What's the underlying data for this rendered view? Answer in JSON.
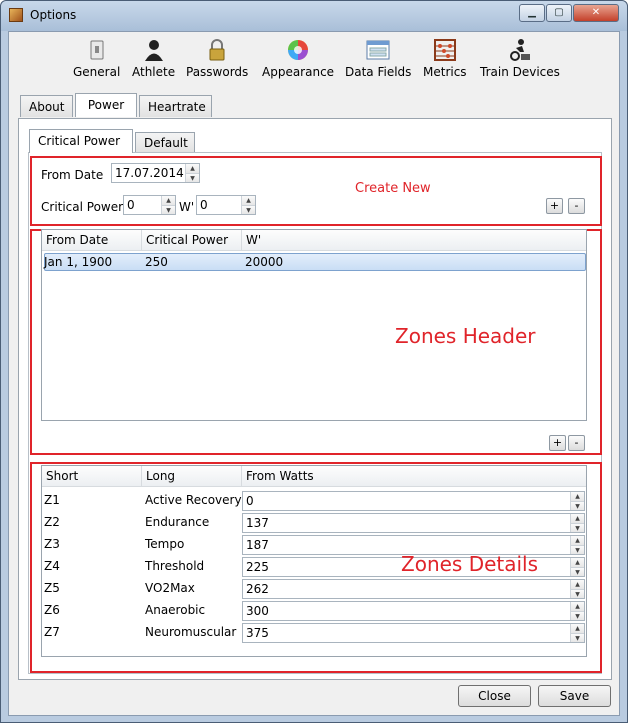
{
  "window": {
    "title": "Options",
    "minimize_label": "▁",
    "maximize_label": "▢",
    "close_label": "✕"
  },
  "toolbar": [
    {
      "label": "General",
      "icon": "switch-icon"
    },
    {
      "label": "Athlete",
      "icon": "person-icon"
    },
    {
      "label": "Passwords",
      "icon": "padlock-icon"
    },
    {
      "label": "Appearance",
      "icon": "color-wheel-icon"
    },
    {
      "label": "Data Fields",
      "icon": "form-icon"
    },
    {
      "label": "Metrics",
      "icon": "abacus-icon"
    },
    {
      "label": "Train Devices",
      "icon": "cyclist-icon"
    }
  ],
  "tabs": [
    {
      "label": "About"
    },
    {
      "label": "Power",
      "active": true
    },
    {
      "label": "Heartrate"
    }
  ],
  "subtabs": [
    {
      "label": "Critical Power",
      "active": true
    },
    {
      "label": "Default"
    }
  ],
  "create": {
    "from_date_label": "From Date",
    "from_date_value": "17.07.2014",
    "cp_label": "Critical Power",
    "cp_value": "0",
    "wprime_label": "W'",
    "wprime_value": "0",
    "add_label": "+",
    "remove_label": "-"
  },
  "annotations": {
    "create_new": "Create New",
    "zones_header": "Zones Header",
    "zones_details": "Zones Details",
    "color": "#e0242a"
  },
  "zones_header": {
    "columns": [
      "From Date",
      "Critical Power",
      "W'"
    ],
    "rows": [
      {
        "date": "Jan 1, 1900",
        "cp": "250",
        "wprime": "20000"
      }
    ],
    "add_label": "+",
    "remove_label": "-"
  },
  "zones": {
    "columns": [
      "Short",
      "Long",
      "From Watts"
    ],
    "rows": [
      {
        "short": "Z1",
        "long": "Active Recovery",
        "watts": "0"
      },
      {
        "short": "Z2",
        "long": "Endurance",
        "watts": "137"
      },
      {
        "short": "Z3",
        "long": "Tempo",
        "watts": "187"
      },
      {
        "short": "Z4",
        "long": "Threshold",
        "watts": "225"
      },
      {
        "short": "Z5",
        "long": "VO2Max",
        "watts": "262"
      },
      {
        "short": "Z6",
        "long": "Anaerobic",
        "watts": "300"
      },
      {
        "short": "Z7",
        "long": "Neuromuscular",
        "watts": "375"
      }
    ]
  },
  "footer": {
    "close_label": "Close",
    "save_label": "Save"
  }
}
